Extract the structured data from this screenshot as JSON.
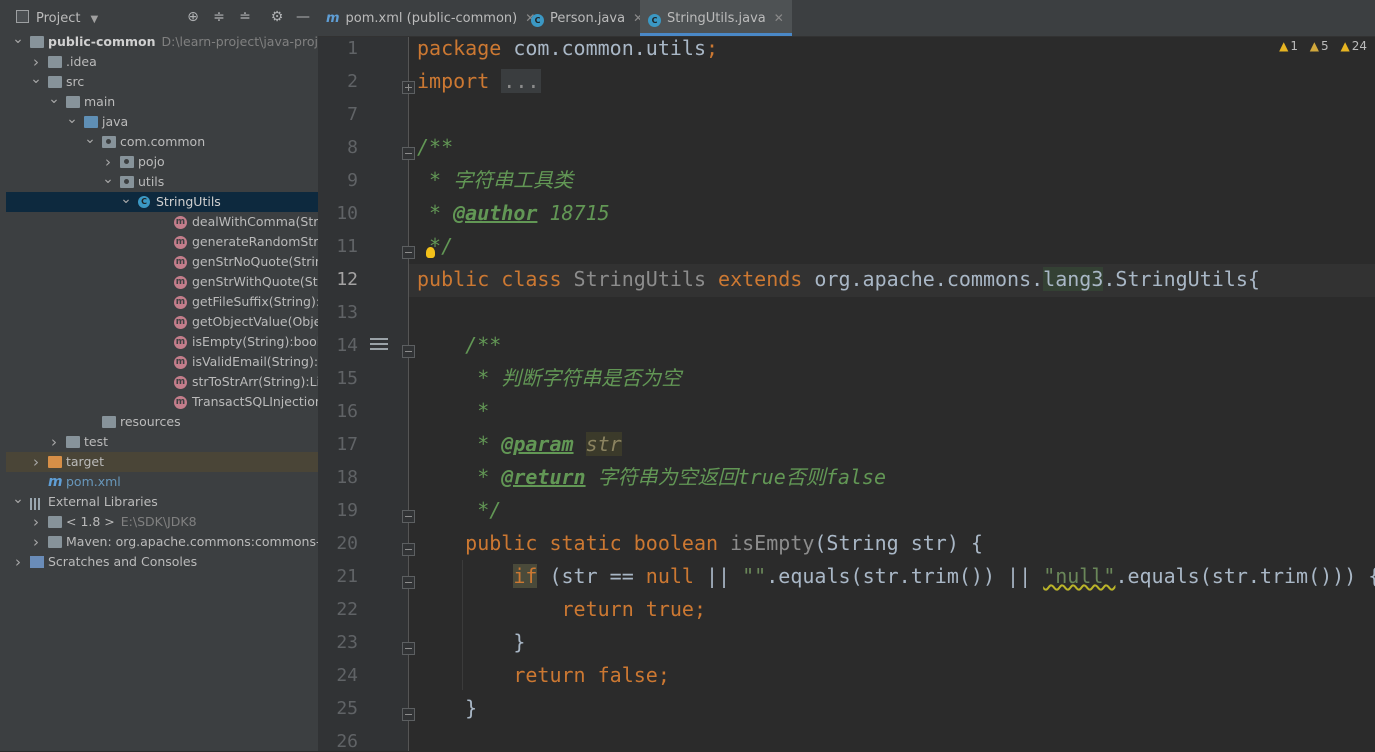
{
  "project_panel": {
    "title": "Project",
    "tree": [
      {
        "label": "public-common",
        "hint": "D:\\learn-project\\java-project",
        "indent": 0,
        "arrow": "down",
        "icon": "module",
        "bold": true
      },
      {
        "label": ".idea",
        "indent": 1,
        "arrow": "right",
        "icon": "folder"
      },
      {
        "label": "src",
        "indent": 1,
        "arrow": "down",
        "icon": "folder"
      },
      {
        "label": "main",
        "indent": 2,
        "arrow": "down",
        "icon": "folder"
      },
      {
        "label": "java",
        "indent": 3,
        "arrow": "down",
        "icon": "src-folder"
      },
      {
        "label": "com.common",
        "indent": 4,
        "arrow": "down",
        "icon": "package"
      },
      {
        "label": "pojo",
        "indent": 5,
        "arrow": "right",
        "icon": "package"
      },
      {
        "label": "utils",
        "indent": 5,
        "arrow": "down",
        "icon": "package"
      },
      {
        "label": "StringUtils",
        "indent": 6,
        "arrow": "down",
        "icon": "class",
        "selected": true
      },
      {
        "label": "dealWithComma(String):S",
        "indent": 8,
        "icon": "method"
      },
      {
        "label": "generateRandomStr(int):",
        "indent": 8,
        "icon": "method"
      },
      {
        "label": "genStrNoQuote(String[])",
        "indent": 8,
        "icon": "method"
      },
      {
        "label": "genStrWithQuote(String[",
        "indent": 8,
        "icon": "method"
      },
      {
        "label": "getFileSuffix(String):String",
        "indent": 8,
        "icon": "method"
      },
      {
        "label": "getObjectValue(Object):S",
        "indent": 8,
        "icon": "method"
      },
      {
        "label": "isEmpty(String):boolean",
        "indent": 8,
        "icon": "method"
      },
      {
        "label": "isValidEmail(String):boole",
        "indent": 8,
        "icon": "method"
      },
      {
        "label": "strToStrArr(String):List<In",
        "indent": 8,
        "icon": "method"
      },
      {
        "label": "TransactSQLInjection(Stri",
        "indent": 8,
        "icon": "method"
      },
      {
        "label": "resources",
        "indent": 4,
        "icon": "folder"
      },
      {
        "label": "test",
        "indent": 2,
        "arrow": "right",
        "icon": "folder"
      },
      {
        "label": "target",
        "indent": 1,
        "arrow": "right",
        "icon": "orange-folder",
        "highlight": true
      },
      {
        "label": "pom.xml",
        "indent": 1,
        "icon": "maven",
        "blue": true
      },
      {
        "label": "External Libraries",
        "indent": 0,
        "arrow": "down",
        "icon": "libraries"
      },
      {
        "label": "< 1.8 >",
        "hint": "E:\\SDK\\JDK8",
        "indent": 1,
        "arrow": "right",
        "icon": "jdk"
      },
      {
        "label": "Maven: org.apache.commons:commons-lar",
        "indent": 1,
        "arrow": "right",
        "icon": "jar"
      },
      {
        "label": "Scratches and Consoles",
        "indent": 0,
        "arrow": "right",
        "icon": "scratches"
      }
    ]
  },
  "tabs": [
    {
      "label": "pom.xml (public-common)",
      "icon": "maven",
      "active": false
    },
    {
      "label": "Person.java",
      "icon": "class",
      "active": false
    },
    {
      "label": "StringUtils.java",
      "icon": "class",
      "active": true
    }
  ],
  "inspections": {
    "warnings_1": "1",
    "warnings_2": "5",
    "weak_warnings": "24"
  },
  "editor": {
    "current_line": 12,
    "lines": [
      "package com.common.utils;",
      "import ...",
      "",
      "/**",
      " * 字符串工具类",
      " * @author 18715",
      " */",
      "public class StringUtils extends org.apache.commons.lang3.StringUtils{",
      "",
      "    /**",
      "     * 判断字符串是否为空",
      "     *",
      "     * @param str",
      "     * @return 字符串为空返回true否则false",
      "     */",
      "    public static boolean isEmpty(String str) {",
      "        if (str == null || \"\".equals(str.trim()) || \"null\".equals(str.trim())) {",
      "            return true;",
      "        }",
      "        return false;",
      "    }",
      ""
    ],
    "line_numbers": [
      "1",
      "2",
      "7",
      "8",
      "9",
      "10",
      "11",
      "12",
      "13",
      "14",
      "15",
      "16",
      "17",
      "18",
      "19",
      "20",
      "21",
      "22",
      "23",
      "24",
      "25",
      "26"
    ]
  }
}
